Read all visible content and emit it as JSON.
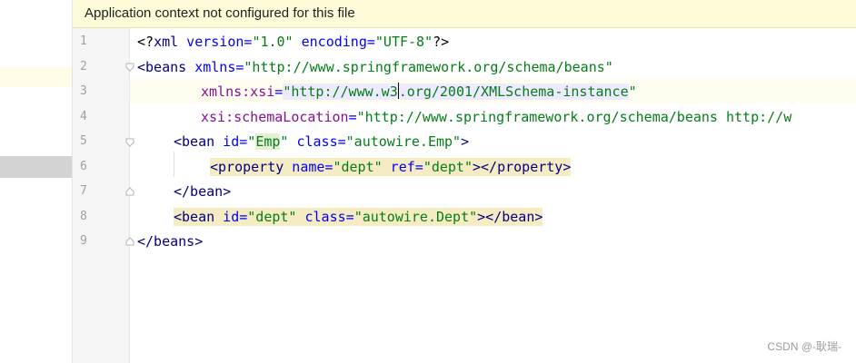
{
  "banner": {
    "message": "Application context not configured for this file"
  },
  "line_numbers": [
    "1",
    "2",
    "3",
    "4",
    "5",
    "6",
    "7",
    "8",
    "9"
  ],
  "code": {
    "l1": {
      "open": "<?",
      "name": "xml",
      "a1": " version=",
      "v1": "\"1.0\"",
      "a2": " encoding=",
      "v2": "\"UTF-8\"",
      "close": "?>"
    },
    "l2": {
      "tag": "<beans",
      "attr": " xmlns=",
      "val": "\"http://www.springframework.org/schema/beans\""
    },
    "l3": {
      "ns": "xmlns:xsi",
      "eq": "=",
      "val_a": "\"http://www.w3",
      "val_b": ".org/2001/XMLSchema-instance",
      "val_c": "\""
    },
    "l4": {
      "ns": "xsi:schemaLocation",
      "eq": "=",
      "val": "\"http://www.springframework.org/schema/beans http://w"
    },
    "l5": {
      "tag": "<bean",
      "a1": " id=",
      "q1": "\"",
      "v1": "Emp",
      "q2": "\"",
      "a2": " class=",
      "v2": "\"autowire.Emp\"",
      "close": ">"
    },
    "l6": {
      "tag": "<property",
      "a1": " name=",
      "v1": "\"dept\"",
      "a2": " ref=",
      "v2": "\"dept\"",
      "close": "></property>"
    },
    "l7": {
      "tag": "</bean>"
    },
    "l8": {
      "tag": "<bean",
      "a1": " id=",
      "v1": "\"dept\"",
      "a2": " class=",
      "v2": "\"autowire.Dept\"",
      "close": "></bean>"
    },
    "l9": {
      "tag": "</beans>"
    }
  },
  "watermark": "CSDN @-耿瑞-"
}
